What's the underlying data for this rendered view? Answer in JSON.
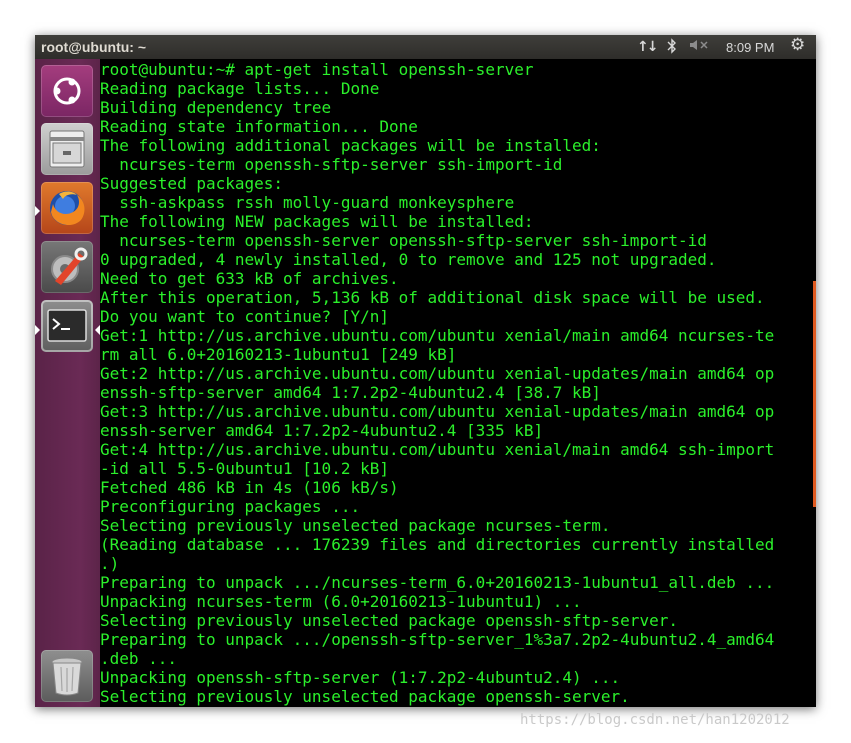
{
  "topbar": {
    "window_title": "root@ubuntu: ~",
    "clock": "8:09 PM",
    "icons": [
      "network-arrows-icon",
      "bluetooth-icon",
      "volume-muted-icon",
      "system-gear-icon"
    ]
  },
  "launcher": {
    "items": [
      {
        "name": "ubuntu-dash",
        "icon": "ubuntu-logo-icon"
      },
      {
        "name": "files",
        "icon": "file-cabinet-icon"
      },
      {
        "name": "firefox",
        "icon": "firefox-icon"
      },
      {
        "name": "system-settings",
        "icon": "settings-wrench-icon"
      },
      {
        "name": "terminal",
        "icon": "terminal-icon"
      },
      {
        "name": "trash",
        "icon": "trash-icon"
      }
    ],
    "terminal_glyph": ">_"
  },
  "terminal": {
    "text_color": "#2bf02b",
    "lines": [
      "root@ubuntu:~# apt-get install openssh-server",
      "Reading package lists... Done",
      "Building dependency tree",
      "Reading state information... Done",
      "The following additional packages will be installed:",
      "  ncurses-term openssh-sftp-server ssh-import-id",
      "Suggested packages:",
      "  ssh-askpass rssh molly-guard monkeysphere",
      "The following NEW packages will be installed:",
      "  ncurses-term openssh-server openssh-sftp-server ssh-import-id",
      "0 upgraded, 4 newly installed, 0 to remove and 125 not upgraded.",
      "Need to get 633 kB of archives.",
      "After this operation, 5,136 kB of additional disk space will be used.",
      "Do you want to continue? [Y/n]",
      "Get:1 http://us.archive.ubuntu.com/ubuntu xenial/main amd64 ncurses-te",
      "rm all 6.0+20160213-1ubuntu1 [249 kB]",
      "Get:2 http://us.archive.ubuntu.com/ubuntu xenial-updates/main amd64 op",
      "enssh-sftp-server amd64 1:7.2p2-4ubuntu2.4 [38.7 kB]",
      "Get:3 http://us.archive.ubuntu.com/ubuntu xenial-updates/main amd64 op",
      "enssh-server amd64 1:7.2p2-4ubuntu2.4 [335 kB]",
      "Get:4 http://us.archive.ubuntu.com/ubuntu xenial/main amd64 ssh-import",
      "-id all 5.5-0ubuntu1 [10.2 kB]",
      "Fetched 486 kB in 4s (106 kB/s)",
      "Preconfiguring packages ...",
      "Selecting previously unselected package ncurses-term.",
      "(Reading database ... 176239 files and directories currently installed",
      ".)",
      "Preparing to unpack .../ncurses-term_6.0+20160213-1ubuntu1_all.deb ...",
      "Unpacking ncurses-term (6.0+20160213-1ubuntu1) ...",
      "Selecting previously unselected package openssh-sftp-server.",
      "Preparing to unpack .../openssh-sftp-server_1%3a7.2p2-4ubuntu2.4_amd64",
      ".deb ...",
      "Unpacking openssh-sftp-server (1:7.2p2-4ubuntu2.4) ...",
      "Selecting previously unselected package openssh-server."
    ]
  },
  "watermark": "https://blog.csdn.net/han1202012"
}
